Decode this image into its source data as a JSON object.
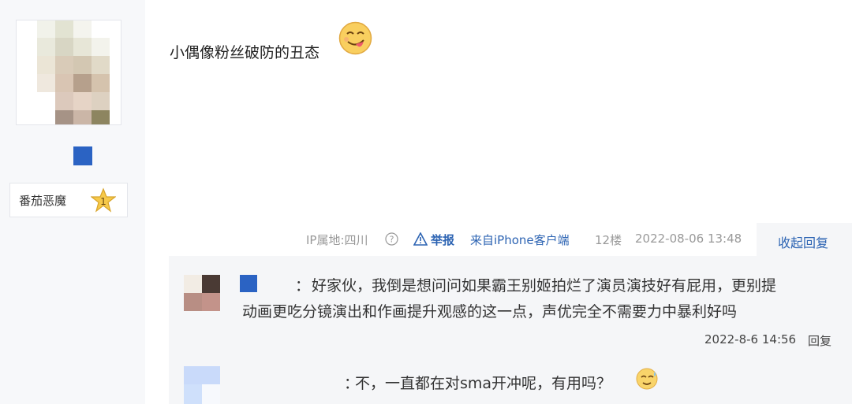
{
  "author": {
    "nickname": "番茄恶魔",
    "level": "1",
    "badge_color": "#2b63c3"
  },
  "post": {
    "text": "小偶像粉丝破防的丑态",
    "emoji": "tongue-face"
  },
  "meta": {
    "ip": "IP属地:四川",
    "report": "举报",
    "source": "来自iPhone客户端",
    "floor": "12楼",
    "datetime": "2022-08-06 13:48",
    "collapse": "收起回复"
  },
  "replies": [
    {
      "prefix": "：",
      "text": "好家伙，我倒是想问问如果霸王别姬拍烂了演员演技好有屁用，更别提",
      "text2": "动画更吃分镜演出和作画提升观感的这一点，声优完全不需要力中暴利好吗",
      "time": "2022-8-6 14:56",
      "reply_label": "回复"
    },
    {
      "prefix": "：",
      "text": "不，一直都在对sma开冲呢，有用吗？",
      "emoji": "sweat-face"
    }
  ],
  "colors": {
    "link": "#2d64b3",
    "muted": "#999999",
    "panel": "#f5f6f8"
  }
}
